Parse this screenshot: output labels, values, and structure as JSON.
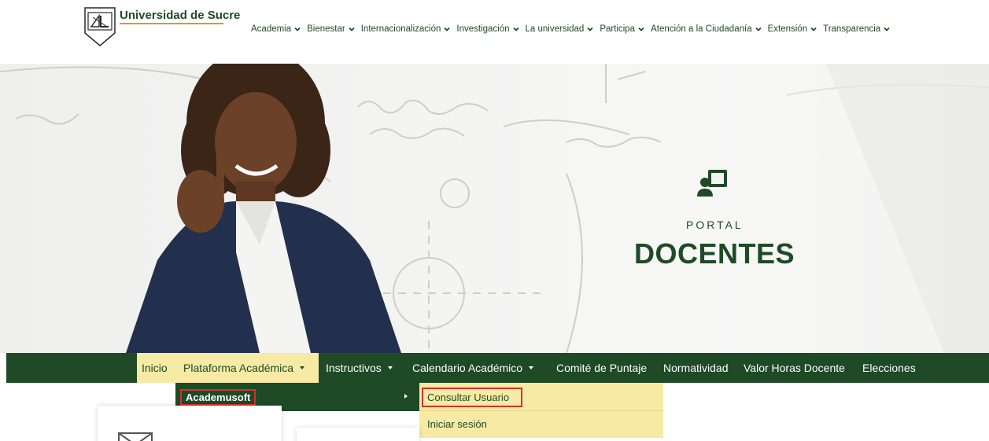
{
  "header": {
    "brand": "Universidad de Sucre",
    "logo_icon": "university-shield-logo",
    "nav": [
      {
        "label": "Academia"
      },
      {
        "label": "Bienestar"
      },
      {
        "label": "Internacionalización"
      },
      {
        "label": "Investigación"
      },
      {
        "label": "La universidad"
      },
      {
        "label": "Participa"
      },
      {
        "label": "Atención a la Ciudadanía"
      },
      {
        "label": "Extensión"
      },
      {
        "label": "Transparencia"
      }
    ]
  },
  "hero": {
    "icon": "teacher-board-icon",
    "subtitle": "PORTAL",
    "title": "DOCENTES"
  },
  "menu": {
    "items": [
      {
        "label": "Inicio"
      },
      {
        "label": "Plataforma Académica"
      },
      {
        "label": "Instructivos"
      },
      {
        "label": "Calendario Académico"
      },
      {
        "label": "Comité de Puntaje"
      },
      {
        "label": "Normatividad"
      },
      {
        "label": "Valor Horas Docente"
      },
      {
        "label": "Elecciones"
      }
    ],
    "active": "Plataforma Académica"
  },
  "dropdown": {
    "level1": [
      {
        "label": "Academusoft"
      }
    ],
    "level2": [
      {
        "label": "Consultar Usuario"
      },
      {
        "label": "Iniciar sesión"
      }
    ]
  },
  "colors": {
    "brand_green": "#1e4a26",
    "highlight_yellow": "#f6eaa4",
    "annotation_red": "#d9302b"
  }
}
